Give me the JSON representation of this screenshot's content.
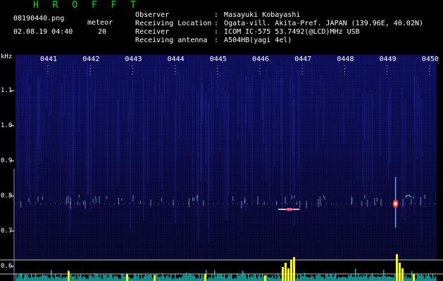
{
  "header": {
    "title": "H R O F F T",
    "file_name": "08190440.png",
    "datetime": "02.08.19 04:40",
    "meteor_label": "meteor",
    "meteor_count": "20"
  },
  "metadata": [
    {
      "key": "Observer",
      "sep": ":",
      "value": "Masayuki Kobayashi"
    },
    {
      "key": "Receiving Location",
      "sep": ":",
      "value": "Ogata-vill. Akita-Pref. JAPAN (139.96E, 40.02N)"
    },
    {
      "key": "Receiver",
      "sep": ":",
      "value": "ICOM IC-575 53.7492(@LCD)MHz USB"
    },
    {
      "key": "Receiving antenna",
      "sep": ":",
      "value": "A504HB(yagi 4el)"
    }
  ],
  "chart_data": {
    "type": "heatmap",
    "y_unit": "kHz",
    "y_ticks": [
      "1.1",
      "1.0",
      "0.9",
      "0.8",
      "0.7",
      "0.6"
    ],
    "y_range": [
      0.57,
      1.17
    ],
    "x_ticks": [
      "0441",
      "0442",
      "0443",
      "0444",
      "0445",
      "0446",
      "0447",
      "0448",
      "0449",
      "0450"
    ],
    "echo_line_khz": 0.78,
    "echoes": [
      {
        "time": "0446.8",
        "freq_khz": 0.78,
        "strength": "medium"
      },
      {
        "time": "0449.2",
        "freq_khz": 0.79,
        "strength": "strong"
      },
      {
        "time": "0449.5",
        "freq_khz": 0.8,
        "strength": "weak"
      }
    ],
    "colors": {
      "background": "#06063a",
      "noise": "#2a2aa0",
      "signal": "#ffffff",
      "strong_signal": "#ff3030",
      "baseline": "#00e0e0",
      "meteor_bars": "#ffff00"
    }
  }
}
